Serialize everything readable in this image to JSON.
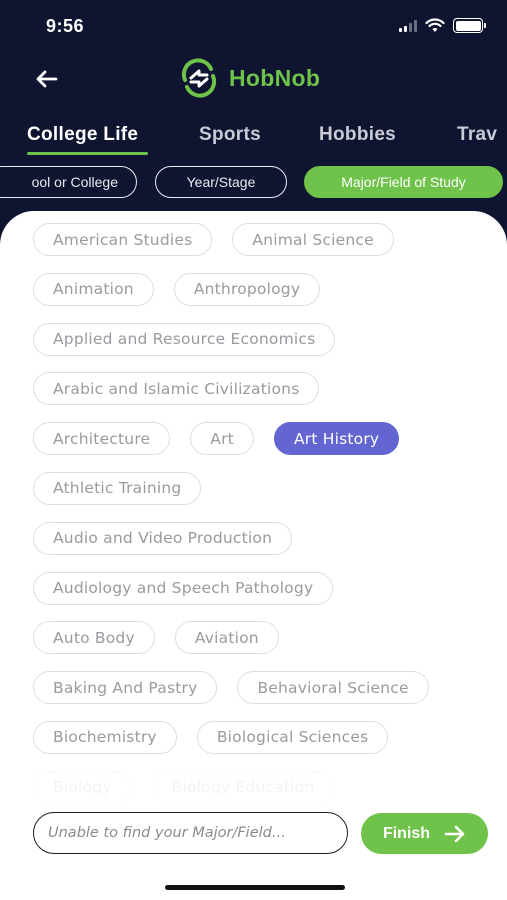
{
  "status_bar": {
    "time": "9:56"
  },
  "header": {
    "logo_text": "HobNob"
  },
  "tabs": [
    {
      "label": "College Life",
      "active": true
    },
    {
      "label": "Sports",
      "active": false
    },
    {
      "label": "Hobbies",
      "active": false
    },
    {
      "label": "Trav",
      "active": false
    }
  ],
  "subtabs": [
    {
      "label": "ool or College",
      "active": false
    },
    {
      "label": "Year/Stage",
      "active": false
    },
    {
      "label": "Major/Field of Study",
      "active": true
    }
  ],
  "chip_rows": [
    [
      "American Studies",
      "Animal Science"
    ],
    [
      "Animation",
      "Anthropology"
    ],
    [
      "Applied and Resource Economics"
    ],
    [
      "Arabic and Islamic Civilizations"
    ],
    [
      "Architecture",
      "Art",
      "Art History"
    ],
    [
      "Athletic Training"
    ],
    [
      "Audio and Video Production"
    ],
    [
      "Audiology and Speech Pathology"
    ],
    [
      "Auto Body",
      "Aviation"
    ],
    [
      "Baking And Pastry",
      "Behavioral Science"
    ],
    [
      "Biochemistry",
      "Biological Sciences"
    ],
    [
      "Biology",
      "Biology Education"
    ]
  ],
  "selected_chip": "Art History",
  "search": {
    "placeholder": "Unable to find your Major/Field..."
  },
  "finish_button": {
    "label": "Finish"
  },
  "colors": {
    "brand_green": "#6fc24a",
    "selected_purple": "#6366d1",
    "dark_bg": "#0f1530"
  }
}
